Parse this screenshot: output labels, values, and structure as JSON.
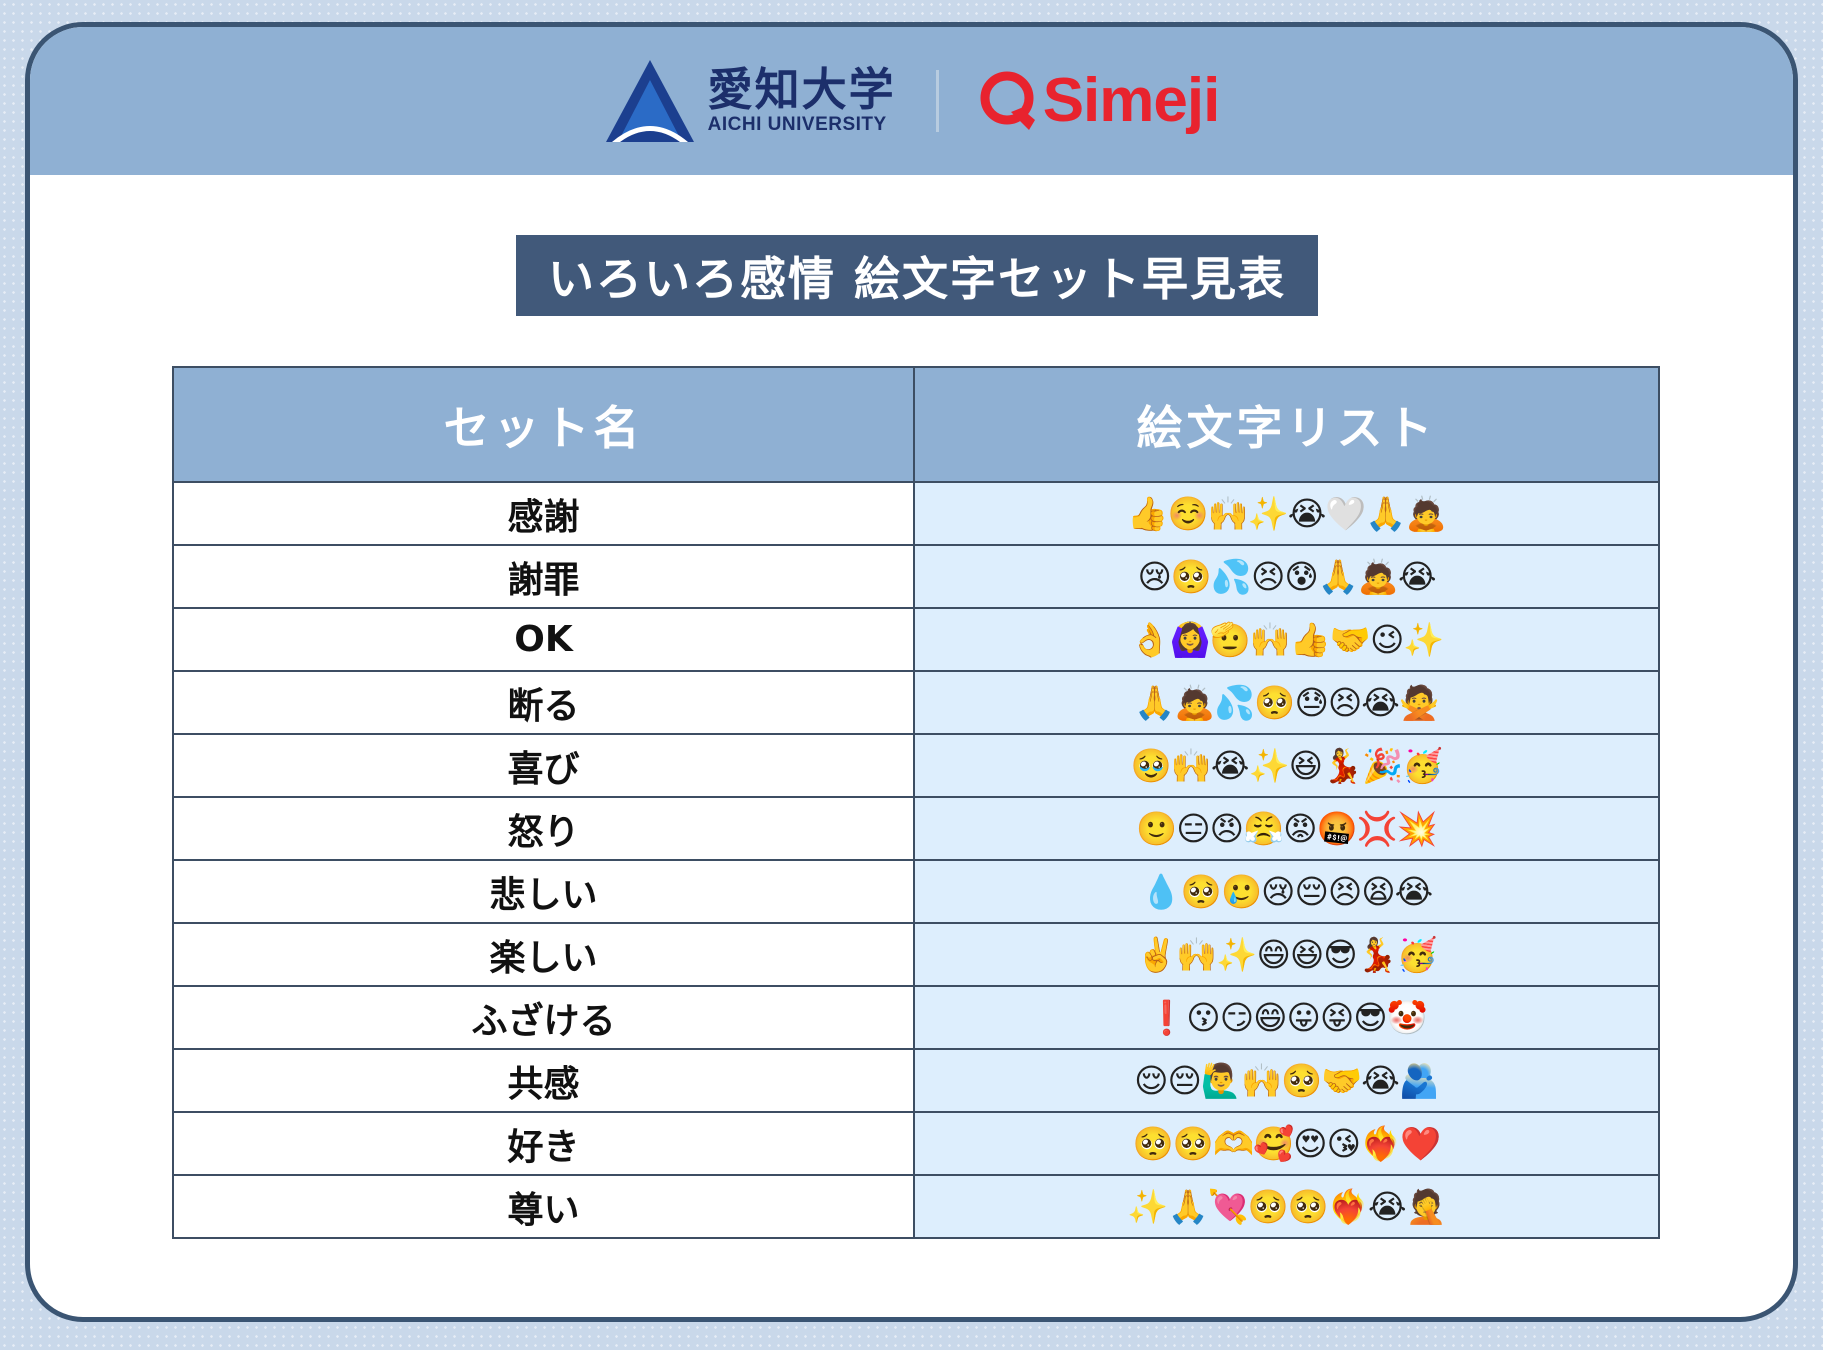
{
  "header": {
    "aichi_name_jp": "愛知大学",
    "aichi_name_en": "AICHI UNIVERSITY",
    "aichi_logo_icon": "triangle-a-icon",
    "simeji_name": "Simeji",
    "simeji_logo_icon": "speech-bubble-q-icon",
    "colors": {
      "band": "#8fb0d3",
      "aichi": "#1c2f6b",
      "simeji": "#e8232e"
    }
  },
  "title": "いろいろ感情 絵文字セット早見表",
  "table": {
    "headers": [
      "セット名",
      "絵文字リスト"
    ],
    "rows": [
      {
        "name": "感謝",
        "emojis": "👍☺️🙌✨😭🤍🙏🙇"
      },
      {
        "name": "謝罪",
        "emojis": "😢🥺💦😣😰🙏🙇😭"
      },
      {
        "name": "OK",
        "emojis": "👌🙆‍♀️🫡🙌👍🤝😉✨"
      },
      {
        "name": "断る",
        "emojis": "🙏🙇💦🥺😓😣😭🙅"
      },
      {
        "name": "喜び",
        "emojis": "🥹🙌😭✨😆💃🎉🥳"
      },
      {
        "name": "怒り",
        "emojis": "🙂😑😠😤😡🤬💢💥"
      },
      {
        "name": "悲しい",
        "emojis": "💧🥺🥲😢😔😣😫😭"
      },
      {
        "name": "楽しい",
        "emojis": "✌️🙌✨😄😆😎💃🥳"
      },
      {
        "name": "ふざける",
        "emojis": "❗😗😏😄😛😝😎🤡"
      },
      {
        "name": "共感",
        "emojis": "😌😔🙋‍♂️🙌🥺🤝😭🫂"
      },
      {
        "name": "好き",
        "emojis": "🥺🥺🫶🥰😍😘❤️‍🔥❤️"
      },
      {
        "name": "尊い",
        "emojis": "✨🙏💘🥺🥺❤️‍🔥😭🤦"
      }
    ]
  },
  "colors": {
    "title_bg": "#41597a",
    "header_bg": "#8fb0d3",
    "emoji_cell_bg": "#ddeefd",
    "border": "#3d4e63"
  }
}
